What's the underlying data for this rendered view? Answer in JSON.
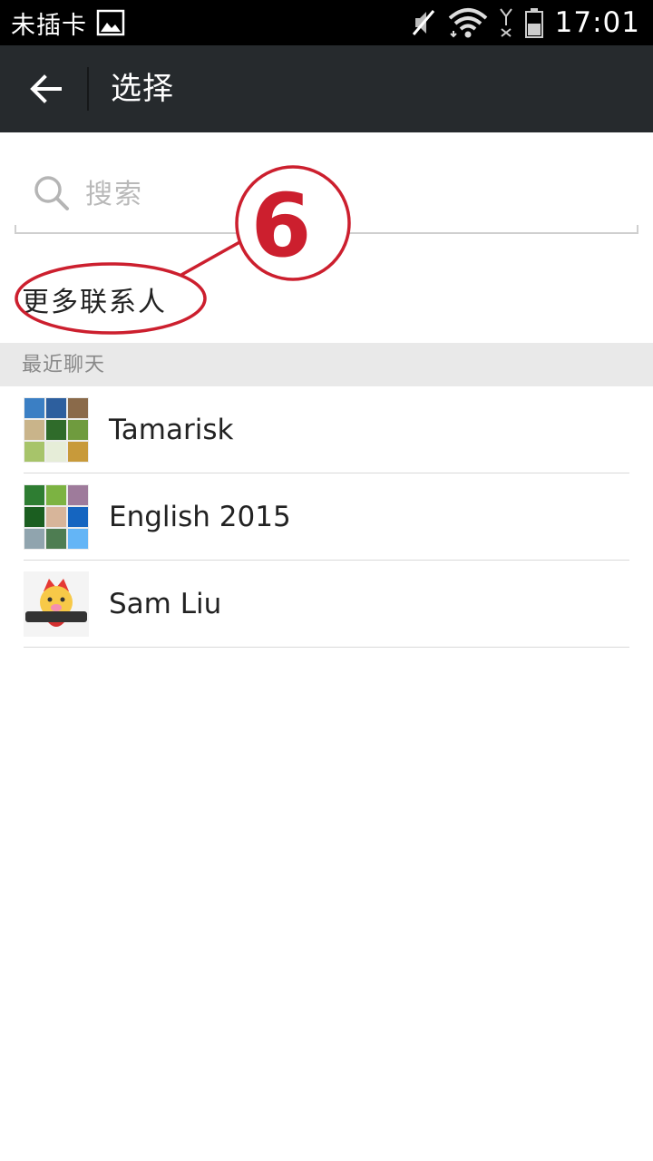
{
  "status_bar": {
    "carrier": "未插卡",
    "time": "17:01",
    "icons": [
      "image-icon",
      "mute-icon",
      "wifi-icon",
      "no-signal-icon",
      "battery-icon"
    ]
  },
  "app_bar": {
    "title": "选择",
    "back_icon": "back-arrow-icon",
    "background": "#262a2d"
  },
  "search": {
    "placeholder": "搜索",
    "value": ""
  },
  "more_contacts": {
    "label": "更多联系人"
  },
  "annotation": {
    "number": "6",
    "color": "#cc1f2e"
  },
  "recent": {
    "header": "最近聊天",
    "chats": [
      {
        "name": "Tamarisk",
        "avatar": "group-avatar-icon"
      },
      {
        "name": "English 2015",
        "avatar": "group-avatar-icon"
      },
      {
        "name": "Sam Liu",
        "avatar": "cartoon-avatar-icon"
      }
    ]
  }
}
